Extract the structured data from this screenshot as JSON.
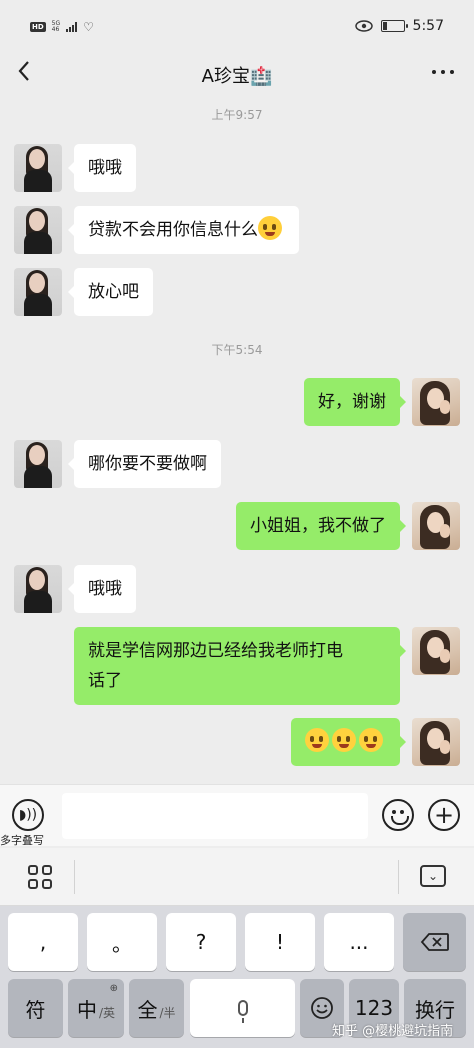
{
  "status_bar": {
    "hd_badge": "HD",
    "net_top": "5G",
    "net_bottom": "46",
    "time": "5:57"
  },
  "header": {
    "title": "A珍宝🏥"
  },
  "timestamps": [
    "上午9:57",
    "下午5:54"
  ],
  "messages": [
    {
      "side": "left",
      "text": "哦哦"
    },
    {
      "side": "left",
      "text": "贷款不会用你信息什么",
      "trailing_emoji": "laugh-cry-emoji"
    },
    {
      "side": "left",
      "text": "放心吧"
    },
    {
      "side": "right",
      "text": "好，谢谢"
    },
    {
      "side": "left",
      "text": "哪你要不要做啊"
    },
    {
      "side": "right",
      "text": "小姐姐，我不做了"
    },
    {
      "side": "left",
      "text": "哦哦"
    },
    {
      "side": "right",
      "line1": "就是学信网那边已经给我老师打电",
      "line2": "话了"
    },
    {
      "side": "right",
      "emoji_only": [
        "crying-face-emoji",
        "crying-face-emoji",
        "crying-face-emoji"
      ]
    }
  ],
  "input_bar": {
    "voice_label": "多字叠写",
    "input_value": "",
    "plus_symbol": "+"
  },
  "keyboard": {
    "row1": [
      ",",
      "。",
      "?",
      "!",
      "..."
    ],
    "row2": {
      "symbol": "符",
      "zh": "中",
      "zh_sub": "/英",
      "full": "全",
      "full_sub": "/半",
      "num": "123",
      "enter": "换行"
    }
  },
  "watermark": "知乎 @樱桃避坑指南",
  "colors": {
    "background": "#ededed",
    "self_bubble": "#95ec69",
    "other_bubble": "#ffffff",
    "keyboard": "#d9dadf"
  }
}
